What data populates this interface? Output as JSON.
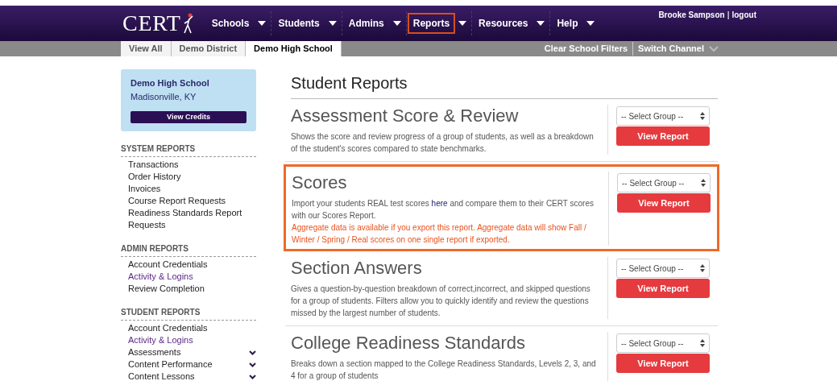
{
  "header": {
    "logo": "CERT",
    "nav": [
      {
        "label": "Schools",
        "selected": false
      },
      {
        "label": "Students",
        "selected": false
      },
      {
        "label": "Admins",
        "selected": false
      },
      {
        "label": "Reports",
        "selected": true
      },
      {
        "label": "Resources",
        "selected": false
      },
      {
        "label": "Help",
        "selected": false
      }
    ],
    "user": "Brooke Sampson",
    "separator": "|",
    "logout": "logout"
  },
  "breadcrumb": {
    "items": [
      {
        "label": "View All",
        "selected": false
      },
      {
        "label": "Demo District",
        "selected": false
      },
      {
        "label": "Demo High School",
        "selected": true
      }
    ],
    "clear_filters": "Clear School Filters",
    "switch_channel": "Switch Channel"
  },
  "sidebar": {
    "school": {
      "name": "Demo High School",
      "location": "Madisonville, KY",
      "button": "View Credits"
    },
    "groups": [
      {
        "title": "SYSTEM REPORTS",
        "items": [
          {
            "label": "Transactions",
            "visited": false,
            "expandable": false
          },
          {
            "label": "Order History",
            "visited": false,
            "expandable": false
          },
          {
            "label": "Invoices",
            "visited": false,
            "expandable": false
          },
          {
            "label": "Course Report Requests",
            "visited": false,
            "expandable": false
          },
          {
            "label": "Readiness Standards Report Requests",
            "visited": false,
            "expandable": false
          }
        ]
      },
      {
        "title": "ADMIN REPORTS",
        "items": [
          {
            "label": "Account Credentials",
            "visited": false,
            "expandable": false
          },
          {
            "label": "Activity & Logins",
            "visited": true,
            "expandable": false
          },
          {
            "label": "Review Completion",
            "visited": false,
            "expandable": false
          }
        ]
      },
      {
        "title": "STUDENT REPORTS",
        "items": [
          {
            "label": "Account Credentials",
            "visited": false,
            "expandable": false
          },
          {
            "label": "Activity & Logins",
            "visited": true,
            "expandable": false
          },
          {
            "label": "Assessments",
            "visited": false,
            "expandable": true
          },
          {
            "label": "Content Performance",
            "visited": false,
            "expandable": true
          },
          {
            "label": "Content Lessons",
            "visited": false,
            "expandable": true
          }
        ]
      }
    ]
  },
  "main": {
    "title": "Student Reports",
    "reports": [
      {
        "title": "Assessment Score & Review",
        "highlighted": false,
        "description": "Shows the score and review progress of a group of students, as well as a breakdown of the student's scores compared to state benchmarks.",
        "select_placeholder": "-- Select Group --",
        "button": "View Report"
      },
      {
        "title": "Scores",
        "highlighted": true,
        "description": "Import your students REAL test scores",
        "link": "here",
        "description_end": "and compare them to their CERT scores with our Scores Report.",
        "note": "Aggregate data is available if you export this report. Aggregate data will show Fall / Winter / Spring / Real scores on one single report if exported.",
        "select_placeholder": "-- Select Group --",
        "button": "View Report"
      },
      {
        "title": "Section Answers",
        "highlighted": false,
        "description": "Gives a question-by-question breakdown of correct,incorrect, and skipped questions for a group of students. Filters allow you to quickly identify and review the questions missed by the largest number of students.",
        "select_placeholder": "-- Select Group --",
        "button": "View Report"
      },
      {
        "title": "College Readiness Standards",
        "highlighted": false,
        "description": "Breaks down a section mapped to the College Readiness Standards, Levels 2, 3, and 4 for a group of students",
        "select_placeholder": "-- Select Group --",
        "button": "View Report"
      }
    ]
  }
}
